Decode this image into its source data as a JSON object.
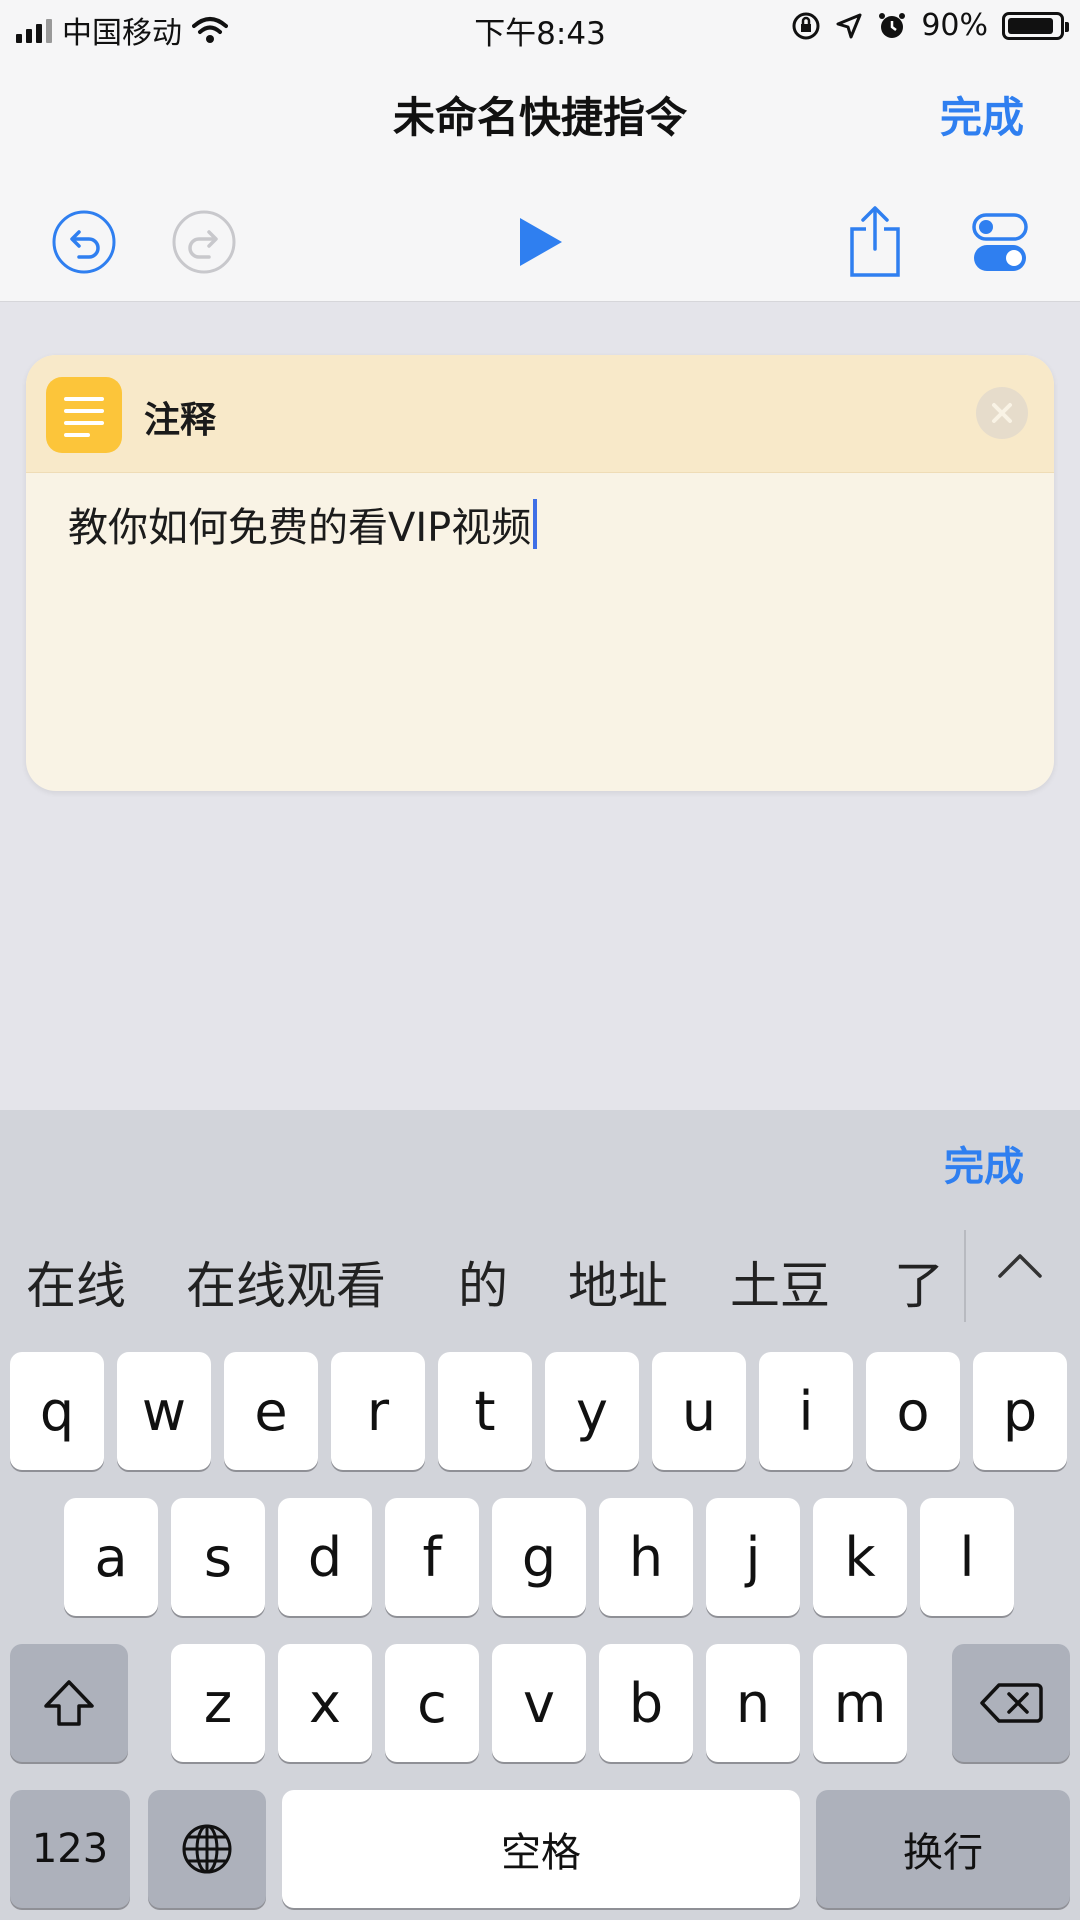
{
  "status_bar": {
    "carrier": "中国移动",
    "time": "下午8:43",
    "battery": "90%",
    "battery_level": 0.9
  },
  "nav": {
    "title": "未命名快捷指令",
    "done_label": "完成"
  },
  "toolbar": {
    "icons": [
      "undo-icon",
      "redo-icon",
      "play-icon",
      "share-icon",
      "settings-toggle-icon"
    ]
  },
  "card": {
    "title": "注释",
    "text": "教你如何免费的看VIP视频",
    "icon": "note-lines-icon",
    "accent_color": "#fcc53a"
  },
  "keyboard": {
    "done_label": "完成",
    "candidates": [
      "在线",
      "在线观看",
      "的",
      "地址",
      "土豆",
      "了"
    ],
    "rows": [
      [
        "q",
        "w",
        "e",
        "r",
        "t",
        "y",
        "u",
        "i",
        "o",
        "p"
      ],
      [
        "a",
        "s",
        "d",
        "f",
        "g",
        "h",
        "j",
        "k",
        "l"
      ],
      [
        "z",
        "x",
        "c",
        "v",
        "b",
        "n",
        "m"
      ]
    ],
    "numbers_label": "123",
    "space_label": "空格",
    "return_label": "换行"
  },
  "colors": {
    "accent": "#2f7ff0",
    "keyboard_bg": "#d2d4da",
    "card_bg": "#f9f3e5"
  }
}
